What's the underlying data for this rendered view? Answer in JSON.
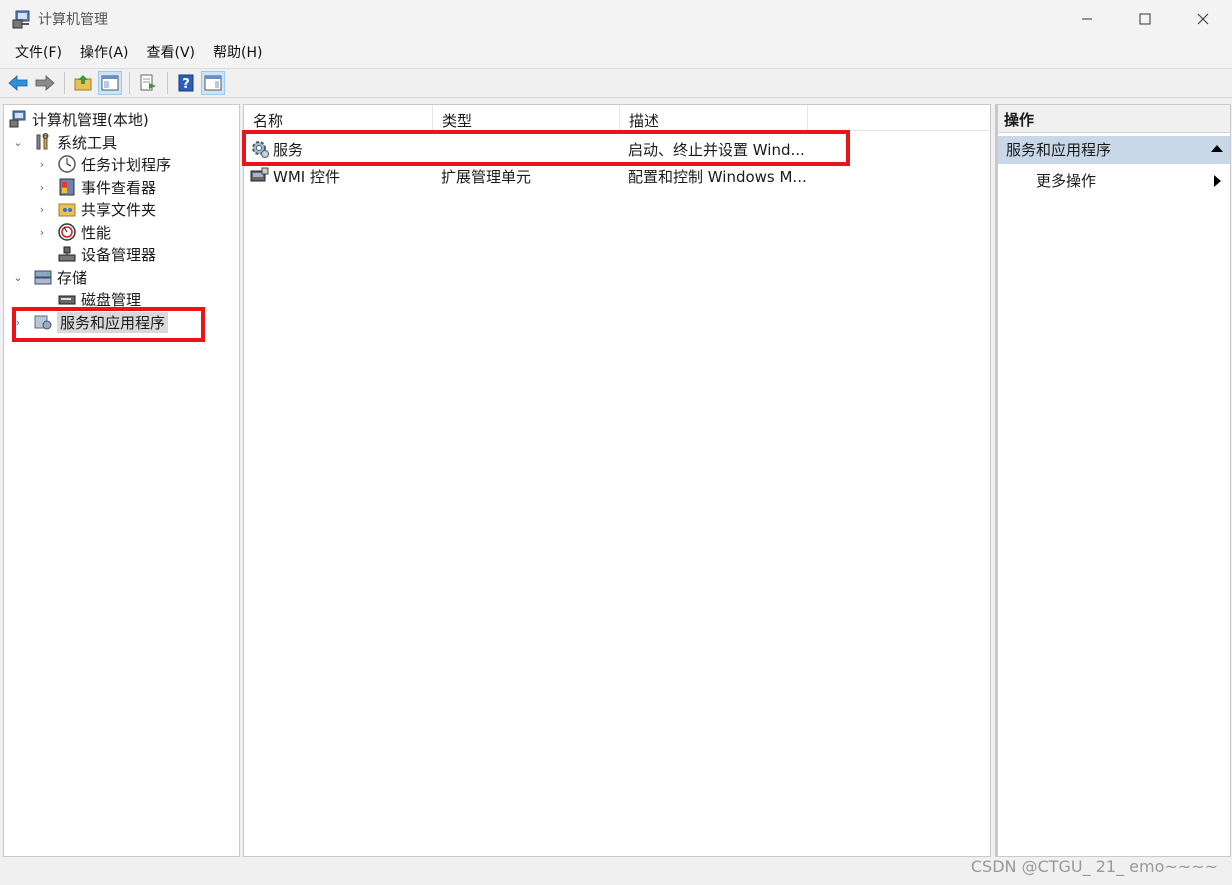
{
  "window": {
    "title": "计算机管理"
  },
  "menu": [
    "文件(F)",
    "操作(A)",
    "查看(V)",
    "帮助(H)"
  ],
  "tree": {
    "root": "计算机管理(本地)",
    "system_tools": "系统工具",
    "task_scheduler": "任务计划程序",
    "event_viewer": "事件查看器",
    "shared_folders": "共享文件夹",
    "performance": "性能",
    "device_manager": "设备管理器",
    "storage": "存储",
    "disk_management": "磁盘管理",
    "services_apps": "服务和应用程序"
  },
  "list": {
    "columns": [
      "名称",
      "类型",
      "描述"
    ],
    "rows": [
      {
        "name": "服务",
        "type": "",
        "desc": "启动、终止并设置 Wind..."
      },
      {
        "name": "WMI 控件",
        "type": "扩展管理单元",
        "desc": "配置和控制 Windows M..."
      }
    ]
  },
  "actions": {
    "header": "操作",
    "section": "服务和应用程序",
    "more": "更多操作"
  },
  "watermark": "CSDN @CTGU_ 21_  emo~~~~",
  "colors": {
    "highlight": "#e8141a",
    "selection": "#d9d9d9",
    "action_section": "#c9d8e8"
  }
}
